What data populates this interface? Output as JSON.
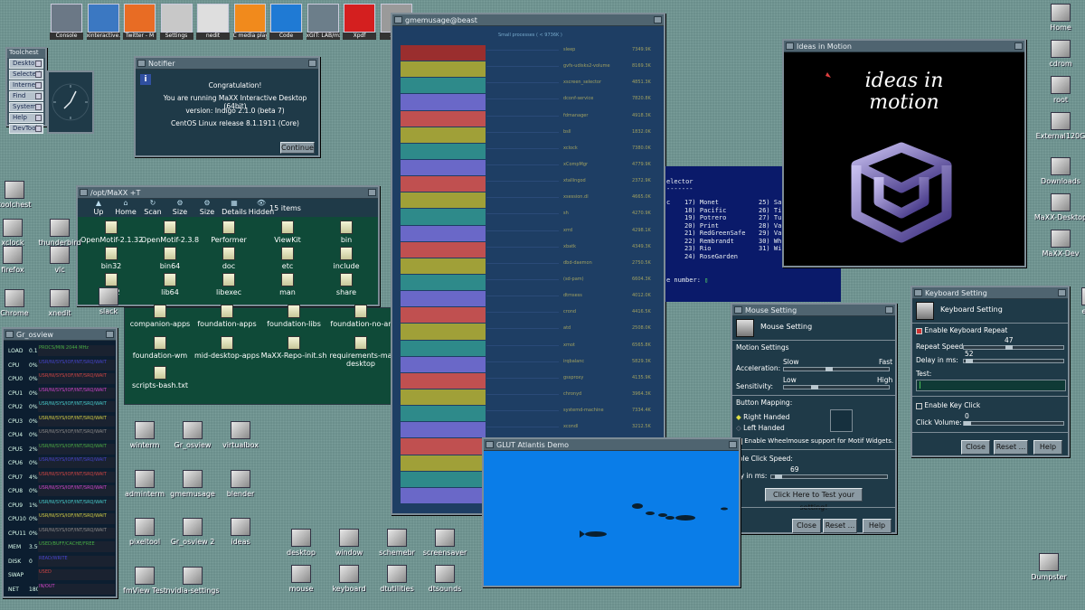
{
  "taskbar": [
    {
      "label": "Console",
      "color": "#6b7886"
    },
    {
      "label": "xinteractive.(",
      "color": "#3b78c2"
    },
    {
      "label": "Twitter - M",
      "color": "#e86c24"
    },
    {
      "label": "Settings",
      "color": "#c8c8c8"
    },
    {
      "label": "nedit",
      "color": "#dedede"
    },
    {
      "label": "C media play",
      "color": "#f18a1c"
    },
    {
      "label": "Code",
      "color": "#1f7ad4"
    },
    {
      "label": "xGIT: LAB/mx",
      "color": "#6c7e8a"
    },
    {
      "label": "Xpdf",
      "color": "#d41f1f"
    },
    {
      "label": "xsso",
      "color": "#9a9a9a"
    }
  ],
  "toolchest": {
    "title": "Toolchest",
    "items": [
      "Desktop",
      "Selected",
      "Internet",
      "Find",
      "System",
      "Help",
      "DevTool"
    ]
  },
  "notifier": {
    "title": "Notifier",
    "lines": [
      "Congratulation!",
      "You are running MaXX Interactive Desktop (64bit)",
      "version: Indigo 2.1.0 (beta 7)",
      "CentOS Linux release 8.1.1911 (Core)"
    ],
    "button": "Continue"
  },
  "filemgr": {
    "title": "/opt/MaXX +T",
    "toolbar": [
      "Up",
      "Home",
      "Scan",
      "Size",
      "Size",
      "Details",
      "Hidden"
    ],
    "count": "15 items",
    "items": [
      "OpenMotif-2.1.32",
      "OpenMotif-2.3.8",
      "Performer",
      "ViewKit",
      "bin",
      "bin32",
      "bin64",
      "doc",
      "etc",
      "include",
      "lib32",
      "lib64",
      "libexec",
      "man",
      "share"
    ]
  },
  "filemgr2": {
    "items": [
      "companion-apps",
      "foundation-apps",
      "foundation-libs",
      "foundation-no-ar",
      "foundation-wm",
      "mid-desktop-apps",
      "MaXX-Repo-init.sh",
      "requirements-ma desktop",
      "scripts-bash.txt"
    ]
  },
  "gmemusage": {
    "title": "gmemusage@beast",
    "header": "Small processes ( < 9736K )",
    "rows": [
      [
        "sleep",
        "7349.9K"
      ],
      [
        "gvfs-udisks2-volume",
        "8169.3K"
      ],
      [
        "xscreen_selector",
        "4851.3K"
      ],
      [
        "dconf-service",
        "7820.8K"
      ],
      [
        "fdmanager",
        "4918.3K"
      ],
      [
        "bsll",
        "1832.0K"
      ],
      [
        "xclock",
        "7380.0K"
      ],
      [
        "xCompMgr",
        "4779.9K"
      ],
      [
        "xtallingod",
        "2372.9K"
      ],
      [
        "xsession.dl",
        "4665.0K"
      ],
      [
        "sh",
        "4270.9K"
      ],
      [
        "xrrd",
        "4298.1K"
      ],
      [
        "xbatk",
        "4349.3K"
      ],
      [
        "dbd-daemon",
        "2750.5K"
      ],
      [
        "(sd-pam)",
        "6604.3K"
      ],
      [
        "dtmsess",
        "4012.0K"
      ],
      [
        "crond",
        "4416.5K"
      ],
      [
        "atd",
        "2508.0K"
      ],
      [
        "xmot",
        "6565.8K"
      ],
      [
        "irqbalanc",
        "5829.3K"
      ],
      [
        "gssproxy",
        "4135.9K"
      ],
      [
        "chronyd",
        "3964.3K"
      ],
      [
        "systemd-machine",
        "7334.4K"
      ],
      [
        "xcondl",
        "3212.5K"
      ],
      [
        "mixmg",
        "2428.8K"
      ],
      [
        "avahi-daemon",
        "3368.0K"
      ],
      [
        "ncsehl",
        "5640.9K"
      ],
      [
        "xonitd",
        "4779.9K"
      ]
    ]
  },
  "bands": [
    "#9a2e2e",
    "#a0a038",
    "#2e8a8a",
    "#6a68c8",
    "#c05050",
    "#a0a038",
    "#2e8a8a",
    "#6a68c8",
    "#c05050",
    "#a0a038",
    "#2e8a8a",
    "#6a68c8",
    "#c05050",
    "#a0a038",
    "#2e8a8a",
    "#6a68c8",
    "#c05050",
    "#a0a038",
    "#2e8a8a",
    "#6a68c8",
    "#c05050",
    "#a0a038",
    "#2e8a8a",
    "#6a68c8",
    "#c05050",
    "#a0a038",
    "#2e8a8a",
    "#6a68c8"
  ],
  "selector": {
    "title": "elector",
    "sep": "-------",
    "left": "c",
    "col1": [
      "17) Monet",
      "18) Pacific",
      "19) Potrero",
      "20) Print",
      "21) RedGreenSafe",
      "22) Rembrandt",
      "23) Rio",
      "24) RoseGarden"
    ],
    "col2": [
      "25) Sa",
      "26) Ti",
      "27) Tu",
      "28) Va",
      "29) Va",
      "30) Wh",
      "31) Wi"
    ],
    "prompt": "e number:"
  },
  "ideas": {
    "title": "Ideas in Motion",
    "text": [
      "ideas in",
      "motion"
    ]
  },
  "mouse": {
    "title": "Mouse Setting",
    "heading": "Mouse Setting",
    "motion": "Motion Settings",
    "accel": "Acceleration:",
    "slow": "Slow",
    "fast": "Fast",
    "sens": "Sensitivity:",
    "low": "Low",
    "high": "High",
    "mapping": "Button Mapping:",
    "right": "Right Handed",
    "left": "Left Handed",
    "wheel": "Enable Wheelmouse support for Motif Widgets.",
    "dbl": "uble Click Speed:",
    "delay": "lay in ms:",
    "delayval": "69",
    "test": "Click Here to Test your setting!",
    "close": "Close",
    "reset": "Reset ...",
    "help": "Help"
  },
  "keyboard": {
    "title": "Keyboard Setting",
    "heading": "Keyboard Setting",
    "repeat": "Enable Keyboard Repeat",
    "rate": "Repeat Speed:",
    "rateval": "47",
    "delay": "Delay in ms:",
    "delayval": "52",
    "test": "Test:",
    "click": "Enable Key Click",
    "vol": "Click Volume:",
    "volval": "0",
    "close": "Close",
    "reset": "Reset ...",
    "help": "Help"
  },
  "atlantis": {
    "title": "GLUT Atlantis Demo"
  },
  "osview": {
    "title": "Gr_osview",
    "rows": [
      [
        "LOAD",
        "0.1",
        "PROCS/MIN 2044 MHz"
      ],
      [
        "CPU",
        "0%",
        "USR/NI/SYS/IOF/INT/SRQ/WAIT"
      ],
      [
        "CPU0",
        "0%",
        "USR/NI/SYS/IOF/INT/SRQ/WAIT"
      ],
      [
        "CPU1",
        "0%",
        "USR/NI/SYS/IOF/INT/SRQ/WAIT"
      ],
      [
        "CPU2",
        "0%",
        "USR/NI/SYS/IOF/INT/SRQ/WAIT"
      ],
      [
        "CPU3",
        "0%",
        "USR/NI/SYS/IOF/INT/SRQ/WAIT"
      ],
      [
        "CPU4",
        "0%",
        "USR/NI/SYS/IOF/INT/SRQ/WAIT"
      ],
      [
        "CPU5",
        "2%",
        "USR/NI/SYS/IOF/INT/SRQ/WAIT"
      ],
      [
        "CPU6",
        "0%",
        "USR/NI/SYS/IOF/INT/SRQ/WAIT"
      ],
      [
        "CPU7",
        "4%",
        "USR/NI/SYS/IOF/INT/SRQ/WAIT"
      ],
      [
        "CPU8",
        "0%",
        "USR/NI/SYS/IOF/INT/SRQ/WAIT"
      ],
      [
        "CPU9",
        "1%",
        "USR/NI/SYS/IOF/INT/SRQ/WAIT"
      ],
      [
        "CPU10",
        "0%",
        "USR/NI/SYS/IOF/INT/SRQ/WAIT"
      ],
      [
        "CPU11",
        "0%",
        "USR/NI/SYS/IOF/INT/SRQ/WAIT"
      ],
      [
        "MEM",
        "3.5G",
        "USED/BUFF/CACHE/FREE"
      ],
      [
        "DISK",
        "0",
        "READ/WRITE"
      ],
      [
        "SWAP",
        "",
        "USED"
      ],
      [
        "NET",
        "180",
        "IN/OUT"
      ]
    ]
  },
  "desktop_left": [
    "toolchest",
    "xclock",
    "thunderbird",
    "firefox",
    "vlc",
    "Chrome",
    "xnedit",
    "slack"
  ],
  "desktop_mid": [
    "winterm",
    "Gr_osview",
    "virtualbox",
    "adminterm",
    "gmemusage",
    "blender",
    "pixeltool",
    "Gr_osview 2",
    "ideas",
    "fmView Test",
    "nvidia-settings"
  ],
  "desktop_bottom": [
    "desktop",
    "window",
    "schemebr",
    "screensaver",
    "mouse",
    "keyboard",
    "dtutilities",
    "dtsounds"
  ],
  "desktop_right": [
    "Home",
    "cdrom",
    "root",
    "External120G",
    "Downloads",
    "MaXX-Desktop",
    "MaXX-Dev",
    "enter",
    "Dumpster"
  ]
}
